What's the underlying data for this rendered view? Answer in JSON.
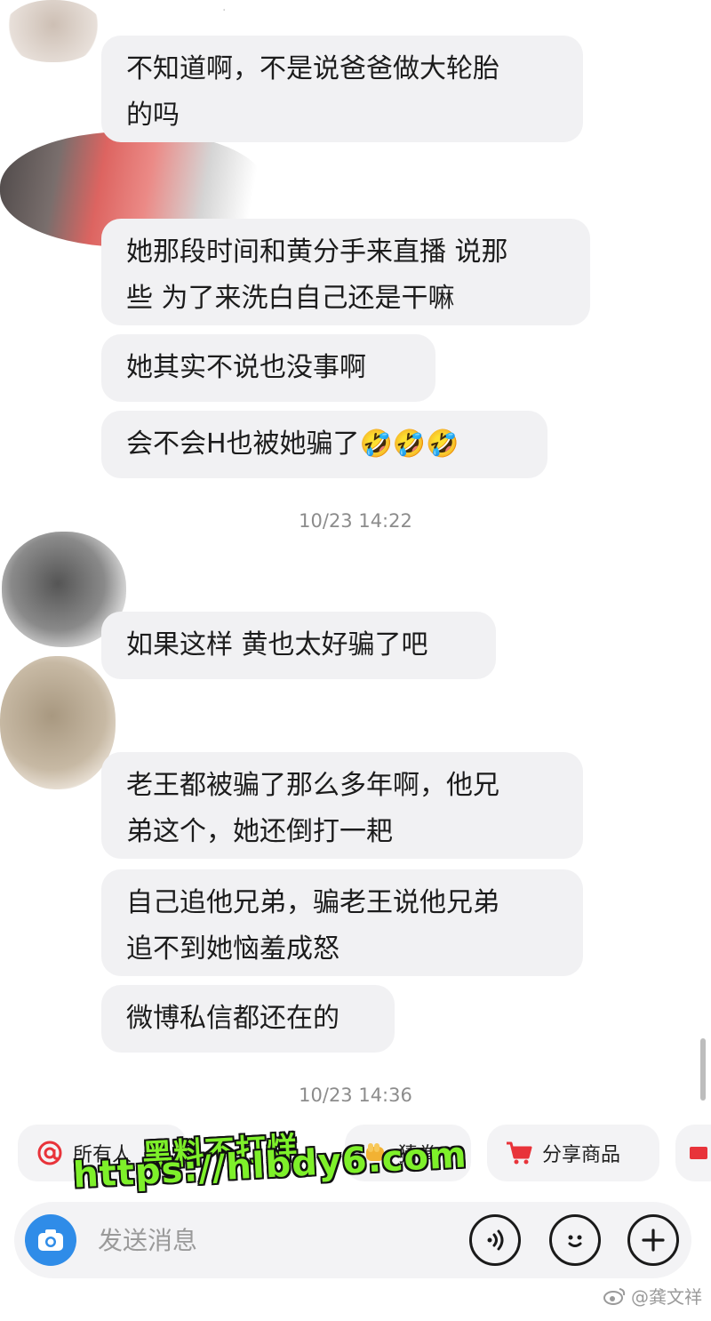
{
  "messages": [
    {
      "text": "不知道啊，不是说爸爸做大轮胎\n的吗"
    },
    {
      "text": "她那段时间和黄分手来直播 说那\n些 为了来洗白自己还是干嘛"
    },
    {
      "text": "她其实不说也没事啊"
    },
    {
      "text": "会不会H也被她骗了🤣🤣🤣"
    },
    {
      "text": "如果这样 黄也太好骗了吧"
    },
    {
      "text": "老王都被骗了那么多年啊，他兄\n弟这个，她还倒打一耙"
    },
    {
      "text": "自己追他兄弟，骗老王说他兄弟\n追不到她恼羞成怒"
    },
    {
      "text": "微博私信都还在的"
    }
  ],
  "timestamps": [
    "10/23 14:22",
    "10/23 14:36"
  ],
  "quick_actions": [
    {
      "label": "所有人",
      "icon": "at-icon"
    },
    {
      "label": "猜拳",
      "icon": "fist-icon"
    },
    {
      "label": "分享商品",
      "icon": "cart-icon"
    }
  ],
  "input": {
    "placeholder": "发送消息"
  },
  "watermark": {
    "line1": "黑料不打烊",
    "line2": "https://hlbdy6.com"
  },
  "credit": "@龚文祥",
  "colors": {
    "accent_blue": "#2f8ce8",
    "cart_red": "#e8333a",
    "watermark_green": "#7ef02a",
    "bubble_bg": "#f1f1f3"
  }
}
